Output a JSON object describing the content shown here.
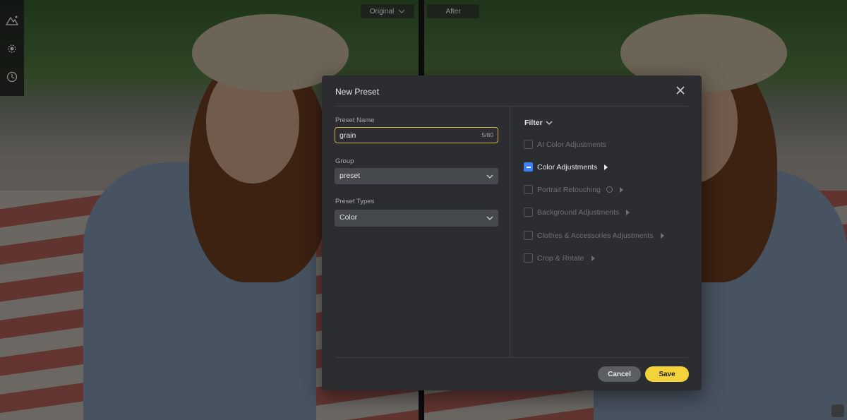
{
  "view": {
    "original_label": "Original",
    "after_label": "After"
  },
  "toolbar": {
    "icons": [
      "mountain-adjust-icon",
      "sun-filter-icon",
      "history-icon"
    ]
  },
  "modal": {
    "title": "New Preset",
    "preset_name": {
      "label": "Preset Name",
      "value": "grain",
      "counter": "5/80"
    },
    "group": {
      "label": "Group",
      "value": "preset"
    },
    "preset_types": {
      "label": "Preset Types",
      "value": "Color"
    },
    "filter": {
      "label": "Filter",
      "options": [
        {
          "label": "AI Color Adjustments",
          "state": "unchecked",
          "arrow": false,
          "info": false
        },
        {
          "label": "Color Adjustments",
          "state": "partial",
          "arrow": true,
          "info": false
        },
        {
          "label": "Portrait Retouching",
          "state": "unchecked",
          "arrow": true,
          "info": true
        },
        {
          "label": "Background Adjustments",
          "state": "unchecked",
          "arrow": true,
          "info": false
        },
        {
          "label": "Clothes & Accessories Adjustments",
          "state": "unchecked",
          "arrow": true,
          "info": false
        },
        {
          "label": "Crop & Rotate",
          "state": "unchecked",
          "arrow": true,
          "info": false
        }
      ]
    },
    "cancel_label": "Cancel",
    "save_label": "Save",
    "colors": {
      "accent": "#f4d33a",
      "checkbox": "#3b82f6",
      "input_border": "#d4b454"
    }
  }
}
